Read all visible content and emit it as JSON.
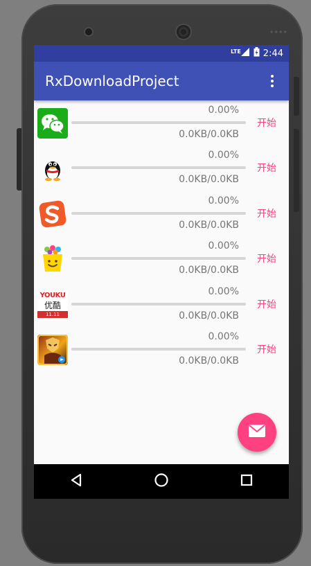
{
  "status_bar": {
    "network": "LTE",
    "time": "2:44"
  },
  "app_bar": {
    "title": "RxDownloadProject"
  },
  "downloads": [
    {
      "app": "WeChat",
      "icon": "wechat-icon",
      "percent": "0.00%",
      "progress": 0,
      "size": "0.0KB/0.0KB",
      "action": "开始"
    },
    {
      "app": "QQ",
      "icon": "qq-penguin-icon",
      "percent": "0.00%",
      "progress": 0,
      "size": "0.0KB/0.0KB",
      "action": "开始"
    },
    {
      "app": "Sogou Input",
      "icon": "sogou-icon",
      "percent": "0.00%",
      "progress": 0,
      "size": "0.0KB/0.0KB",
      "action": "开始"
    },
    {
      "app": "App Store",
      "icon": "shopping-bag-icon",
      "percent": "0.00%",
      "progress": 0,
      "size": "0.0KB/0.0KB",
      "action": "开始"
    },
    {
      "app": "Youku",
      "icon": "youku-icon",
      "percent": "0.00%",
      "progress": 0,
      "size": "0.0KB/0.0KB",
      "action": "开始",
      "icon_text": {
        "brand": "YOUKU",
        "cn": "优酷",
        "date": "11.11"
      }
    },
    {
      "app": "Game",
      "icon": "game-hero-icon",
      "percent": "0.00%",
      "progress": 0,
      "size": "0.0KB/0.0KB",
      "action": "开始"
    }
  ],
  "fab": {
    "icon": "email-icon"
  },
  "nav_bar": {
    "back": "back-icon",
    "home": "home-icon",
    "recents": "recents-icon"
  },
  "colors": {
    "primary": "#3f51b5",
    "primary_dark": "#303f9f",
    "accent": "#ff4081"
  }
}
